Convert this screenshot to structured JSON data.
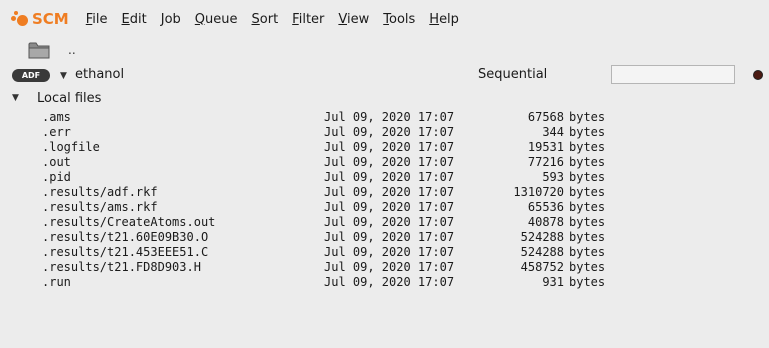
{
  "app": {
    "logo_text": "SCM",
    "brand_color": "#ef7d22"
  },
  "menu": [
    {
      "accel": "F",
      "rest": "ile"
    },
    {
      "accel": "E",
      "rest": "dit"
    },
    {
      "accel": "J",
      "rest": "ob"
    },
    {
      "accel": "Q",
      "rest": "ueue"
    },
    {
      "accel": "S",
      "rest": "ort"
    },
    {
      "accel": "F",
      "rest": "ilter"
    },
    {
      "accel": "V",
      "rest": "iew"
    },
    {
      "accel": "T",
      "rest": "ools"
    },
    {
      "accel": "H",
      "rest": "elp"
    }
  ],
  "folder": {
    "icon": "folder-icon",
    "parent_label": ".."
  },
  "job": {
    "badge": "ADF",
    "name": "ethanol",
    "queue_mode": "Sequential",
    "queue_field_value": "",
    "status_color": "#4a1a12"
  },
  "local_files": {
    "label": "Local files",
    "files": [
      {
        "name": ".ams",
        "date": "Jul 09, 2020 17:07",
        "size": "67568",
        "unit": "bytes"
      },
      {
        "name": ".err",
        "date": "Jul 09, 2020 17:07",
        "size": "344",
        "unit": "bytes"
      },
      {
        "name": ".logfile",
        "date": "Jul 09, 2020 17:07",
        "size": "19531",
        "unit": "bytes"
      },
      {
        "name": ".out",
        "date": "Jul 09, 2020 17:07",
        "size": "77216",
        "unit": "bytes"
      },
      {
        "name": ".pid",
        "date": "Jul 09, 2020 17:07",
        "size": "593",
        "unit": "bytes"
      },
      {
        "name": ".results/adf.rkf",
        "date": "Jul 09, 2020 17:07",
        "size": "1310720",
        "unit": "bytes"
      },
      {
        "name": ".results/ams.rkf",
        "date": "Jul 09, 2020 17:07",
        "size": "65536",
        "unit": "bytes"
      },
      {
        "name": ".results/CreateAtoms.out",
        "date": "Jul 09, 2020 17:07",
        "size": "40878",
        "unit": "bytes"
      },
      {
        "name": ".results/t21.60E09B30.O",
        "date": "Jul 09, 2020 17:07",
        "size": "524288",
        "unit": "bytes"
      },
      {
        "name": ".results/t21.453EEE51.C",
        "date": "Jul 09, 2020 17:07",
        "size": "524288",
        "unit": "bytes"
      },
      {
        "name": ".results/t21.FD8D903.H",
        "date": "Jul 09, 2020 17:07",
        "size": "458752",
        "unit": "bytes"
      },
      {
        "name": ".run",
        "date": "Jul 09, 2020 17:07",
        "size": "931",
        "unit": "bytes"
      }
    ]
  }
}
